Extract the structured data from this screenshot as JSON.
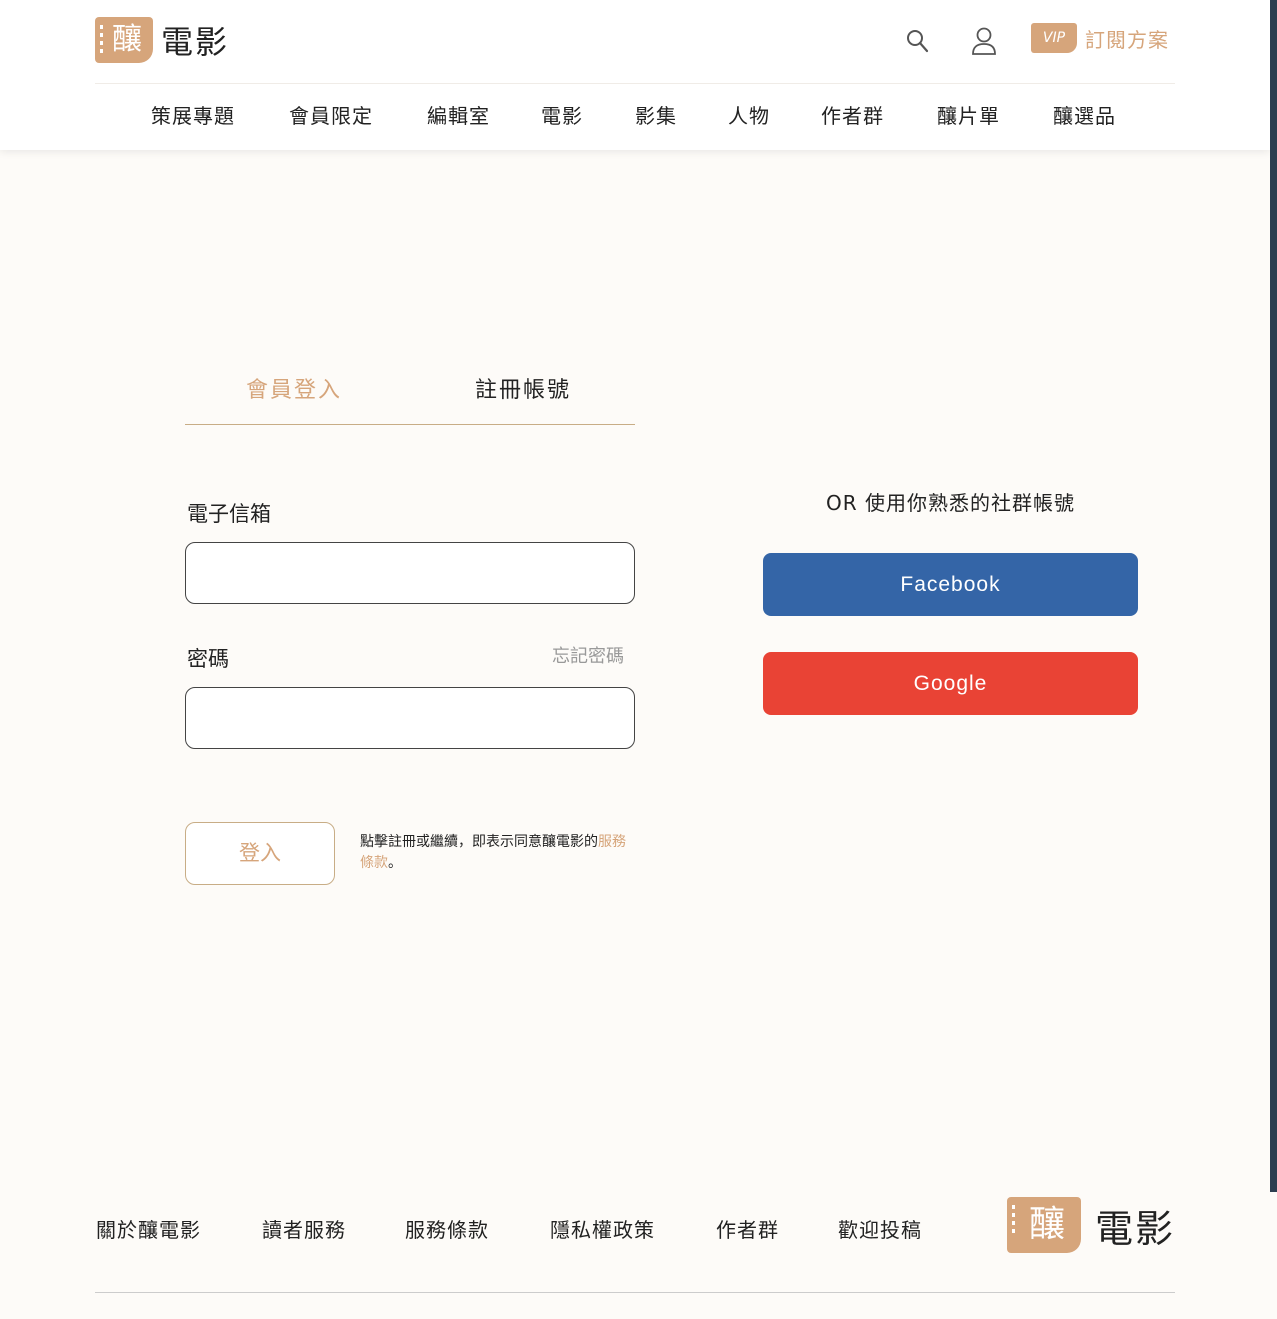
{
  "header": {
    "logo_mark": "釀",
    "logo_text": "電影",
    "vip_badge": "VIP",
    "vip_label": "訂閱方案",
    "nav": [
      "策展專題",
      "會員限定",
      "編輯室",
      "電影",
      "影集",
      "人物",
      "作者群",
      "釀片單",
      "釀選品"
    ]
  },
  "tabs": {
    "login": "會員登入",
    "register": "註冊帳號"
  },
  "form": {
    "email_label": "電子信箱",
    "password_label": "密碼",
    "forgot": "忘記密碼",
    "login_button": "登入",
    "terms_prefix": "點擊註冊或繼續，即表示同意釀電影的",
    "terms_link": "服務條款",
    "terms_suffix": "。"
  },
  "social": {
    "title": "OR 使用你熟悉的社群帳號",
    "facebook": "Facebook",
    "google": "Google"
  },
  "footer": {
    "links": [
      "關於釀電影",
      "讀者服務",
      "服務條款",
      "隱私權政策",
      "作者群",
      "歡迎投稿"
    ],
    "logo_mark": "釀",
    "logo_text": "電影"
  },
  "colors": {
    "accent": "#d6a57b",
    "facebook": "#3465a7",
    "google": "#e94335",
    "background": "#fdfbf8"
  },
  "icons": [
    "search-icon",
    "user-icon"
  ]
}
